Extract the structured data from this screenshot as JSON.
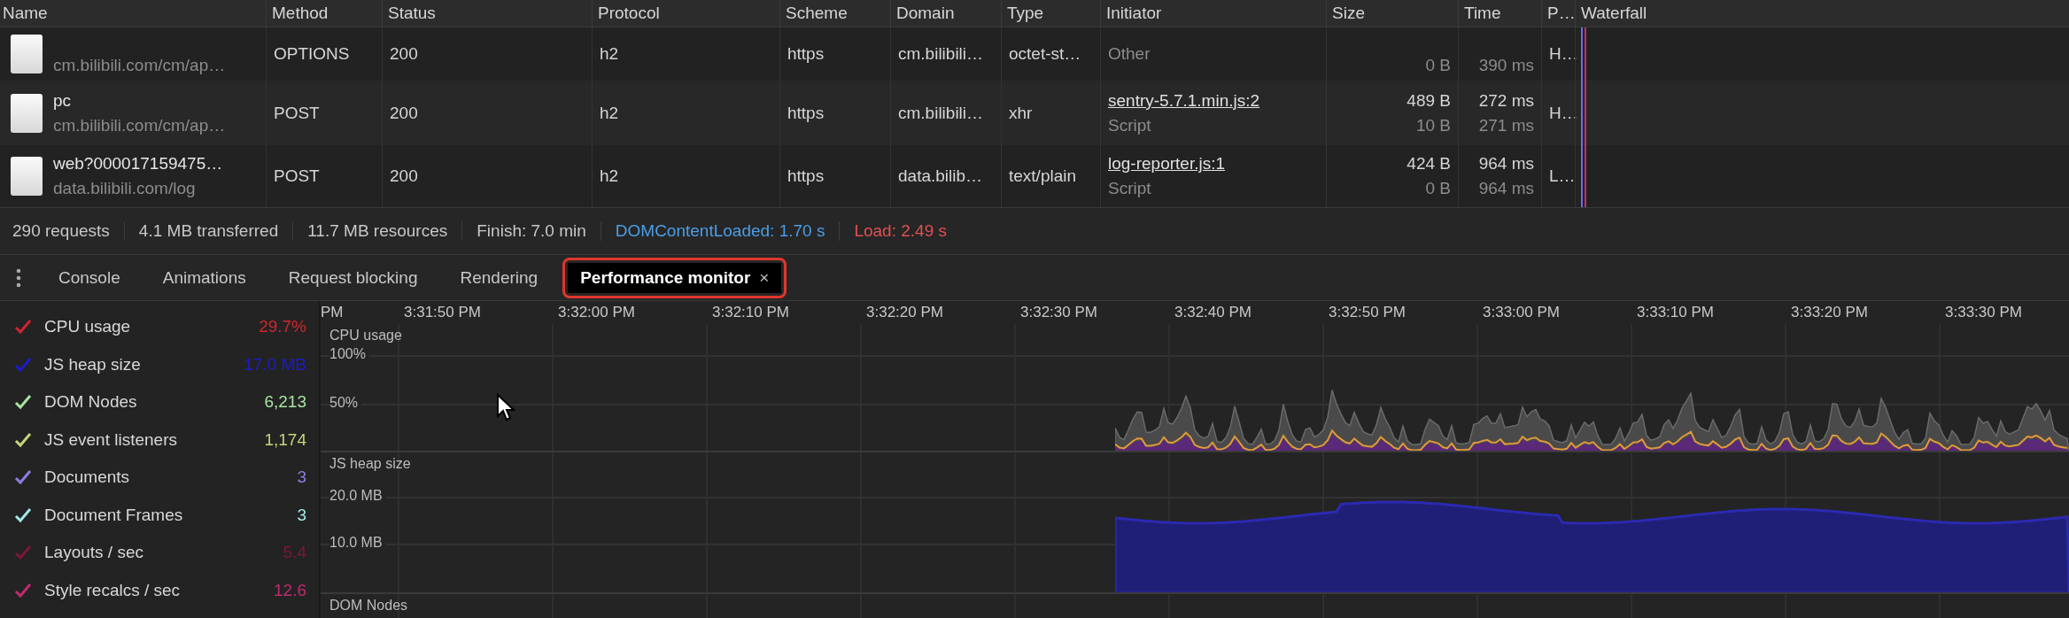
{
  "columns": [
    "Name",
    "Method",
    "Status",
    "Protocol",
    "Scheme",
    "Domain",
    "Type",
    "Initiator",
    "Size",
    "Time",
    "P…",
    "Waterfall"
  ],
  "rows": [
    {
      "path": "cm.bilibili.com/cm/ap…",
      "method": "OPTIONS",
      "status": "200",
      "protocol": "h2",
      "scheme": "https",
      "domain": "cm.bilibili…",
      "type": "octet-st…",
      "initiator": "Other",
      "initiator_link": false,
      "size_sub": "0 B",
      "time_sub": "390 ms",
      "priority": "H…"
    },
    {
      "name": "pc",
      "path": "cm.bilibili.com/cm/ap…",
      "method": "POST",
      "status": "200",
      "protocol": "h2",
      "scheme": "https",
      "domain": "cm.bilibili…",
      "type": "xhr",
      "initiator": "sentry-5.7.1.min.js:2",
      "initiator_link": true,
      "initiator_sub": "Script",
      "size": "489 B",
      "size_sub": "10 B",
      "time": "272 ms",
      "time_sub": "271 ms",
      "priority": "H…"
    },
    {
      "name": "web?000017159475…",
      "path": "data.bilibili.com/log",
      "method": "POST",
      "status": "200",
      "protocol": "h2",
      "scheme": "https",
      "domain": "data.bilib…",
      "type": "text/plain",
      "initiator": "log-reporter.js:1",
      "initiator_link": true,
      "initiator_sub": "Script",
      "size": "424 B",
      "size_sub": "0 B",
      "time": "964 ms",
      "time_sub": "964 ms",
      "priority": "L…"
    }
  ],
  "summary": [
    {
      "text": "290 requests",
      "kind": "plain"
    },
    {
      "text": "4.1 MB transferred",
      "kind": "plain"
    },
    {
      "text": "11.7 MB resources",
      "kind": "plain"
    },
    {
      "text": "Finish: 7.0 min",
      "kind": "plain"
    },
    {
      "text": "DOMContentLoaded: 1.70 s",
      "kind": "dcl"
    },
    {
      "text": "Load: 2.49 s",
      "kind": "load"
    }
  ],
  "tabs": [
    {
      "label": "Console",
      "selected": false,
      "highlighted": false
    },
    {
      "label": "Animations",
      "selected": false,
      "highlighted": false
    },
    {
      "label": "Request blocking",
      "selected": false,
      "highlighted": false
    },
    {
      "label": "Rendering",
      "selected": false,
      "highlighted": false
    },
    {
      "label": "Performance monitor",
      "selected": true,
      "highlighted": true,
      "close": "×"
    }
  ],
  "metrics": [
    {
      "label": "CPU usage",
      "value": "29.7%",
      "color": "#d0262e",
      "checked": true
    },
    {
      "label": "JS heap size",
      "value": "17.0 MB",
      "color": "#1c1cc8",
      "checked": true
    },
    {
      "label": "DOM Nodes",
      "value": "6,213",
      "color": "#a6e3a0",
      "checked": true
    },
    {
      "label": "JS event listeners",
      "value": "1,174",
      "color": "#c8d47a",
      "checked": true
    },
    {
      "label": "Documents",
      "value": "3",
      "color": "#8c7ee0",
      "checked": true
    },
    {
      "label": "Document Frames",
      "value": "3",
      "color": "#a2e8e4",
      "checked": true
    },
    {
      "label": "Layouts / sec",
      "value": "5.4",
      "color": "#7a1838",
      "checked": true
    },
    {
      "label": "Style recalcs / sec",
      "value": "12.6",
      "color": "#c02a70",
      "checked": true
    }
  ],
  "timeline": [
    "PM",
    "3:31:50 PM",
    "3:32:00 PM",
    "3:32:10 PM",
    "3:32:20 PM",
    "3:32:30 PM",
    "3:32:40 PM",
    "3:32:50 PM",
    "3:33:00 PM",
    "3:33:10 PM",
    "3:33:20 PM",
    "3:33:30 PM"
  ],
  "charts": [
    {
      "kind": "cpu",
      "title": "CPU usage",
      "ticks": [
        "100%",
        "50%"
      ]
    },
    {
      "kind": "heap",
      "title": "JS heap size",
      "ticks": [
        "20.0 MB",
        "10.0 MB"
      ]
    },
    {
      "kind": "dom",
      "title": "DOM Nodes"
    }
  ]
}
